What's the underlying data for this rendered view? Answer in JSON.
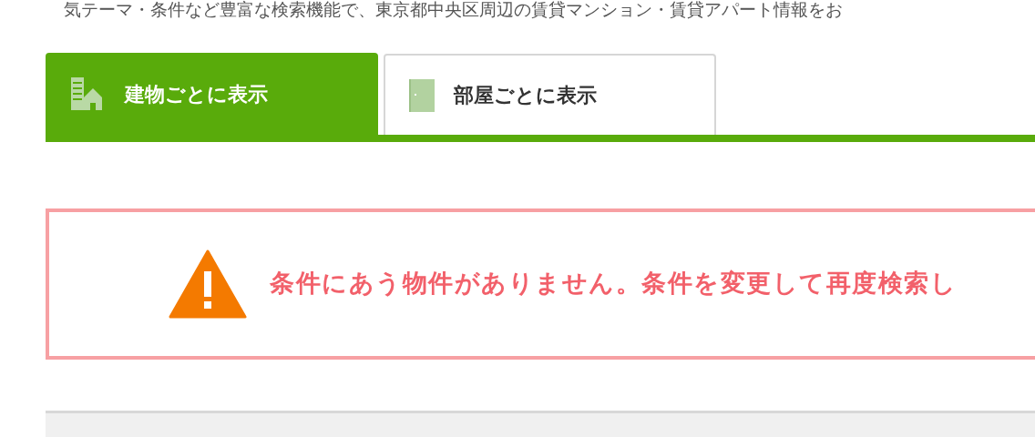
{
  "intro_text": "気テーマ・条件など豊富な検索機能で、東京都中央区周辺の賃貸マンション・賃貸アパート情報をお",
  "tabs": [
    {
      "label": "建物ごとに表示",
      "selected": true,
      "kind": "building"
    },
    {
      "label": "部屋ごとに表示",
      "selected": false,
      "kind": "room"
    }
  ],
  "alert": {
    "message": "条件にあう物件がありません。条件を変更して再度検索し"
  }
}
